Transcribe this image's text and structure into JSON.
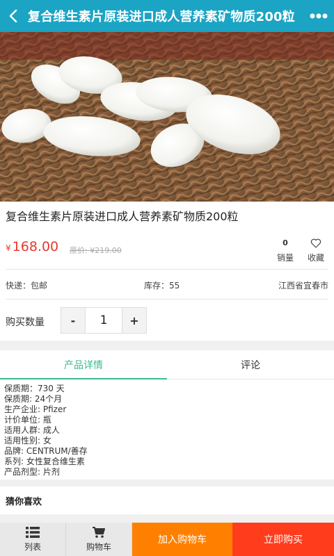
{
  "header": {
    "title": "复合维生素片原装进口成人营养素矿物质200粒",
    "back_icon": "chevron-left-icon",
    "more_icon": "more-dots-icon",
    "accent_color": "#1ba4c4"
  },
  "product": {
    "title": "复合维生素片原装进口成人营养素矿物质200粒",
    "currency": "¥",
    "price": "168.00",
    "original_price": "原价: ¥219.00",
    "sales_count": "0",
    "sales_label": "销量",
    "favorite_label": "收藏",
    "shipping": "快递：包邮",
    "stock": "库存：55",
    "location": "江西省宜春市",
    "quantity_label": "购买数量",
    "quantity": "1",
    "minus_label": "-",
    "plus_label": "+"
  },
  "tabs": [
    {
      "label": "产品详情",
      "active": true
    },
    {
      "label": "评论",
      "active": false
    }
  ],
  "details": [
    "保质期：730 天",
    "保质期: 24个月",
    "生产企业: Pfizer",
    "计价单位: 瓶",
    "适用人群: 成人",
    "适用性别: 女",
    "品牌: CENTRUM/善存",
    "系列: 女性复合维生素",
    "产品剂型: 片剂"
  ],
  "guess_title": "猜你喜欢",
  "bottom_bar": {
    "list_label": "列表",
    "cart_label": "购物车",
    "add_to_cart": "加入购物车",
    "buy_now": "立即购买"
  },
  "colors": {
    "price": "#e8382c",
    "tab_active": "#3cb98c",
    "add_to_cart_bg": "#ff8000",
    "buy_now_bg": "#ff3c1c"
  }
}
